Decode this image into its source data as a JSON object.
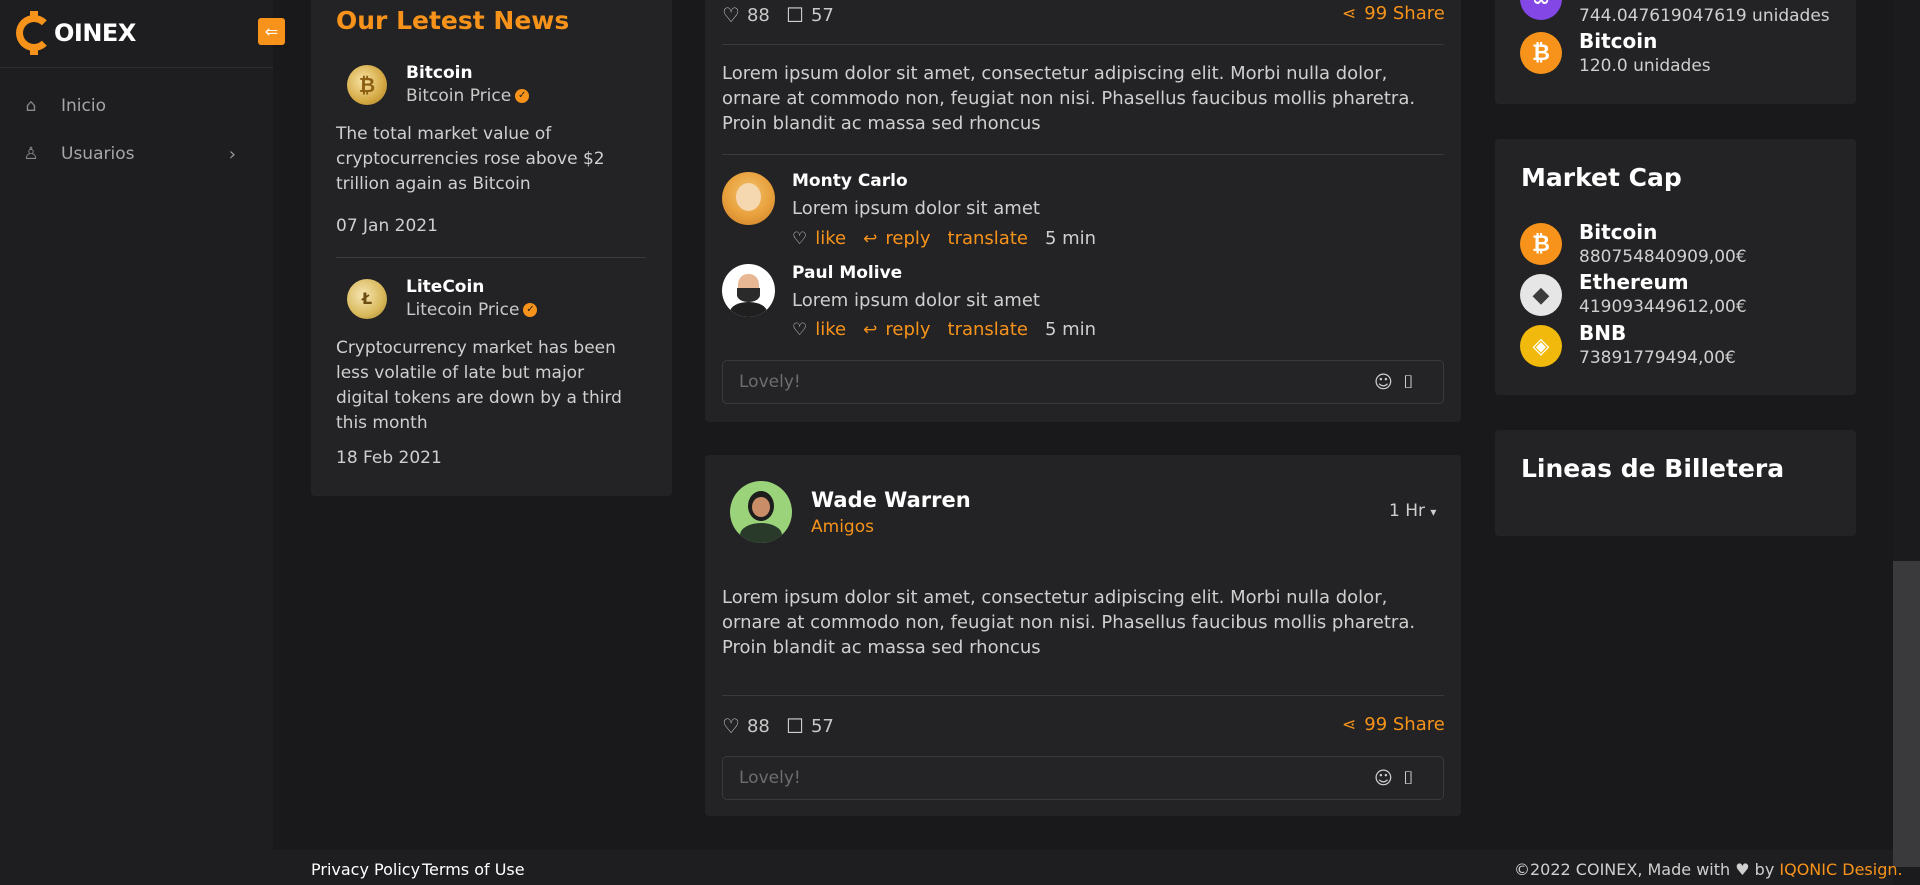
{
  "brand": {
    "name": "OINEX",
    "accent": "#f7931a",
    "collapse_icon": "arrow-left-icon"
  },
  "sidebar": {
    "items": [
      {
        "label": "Inicio",
        "icon": "home-icon"
      },
      {
        "label": "Usuarios",
        "icon": "user-icon",
        "chevron": "chevron-right-icon"
      }
    ]
  },
  "news": {
    "title": "Our Letest News",
    "items": [
      {
        "name": "Bitcoin",
        "sub": "Bitcoin Price",
        "body": "The total market value of cryptocurrencies rose above $2 trillion again as Bitcoin",
        "date": "07 Jan 2021"
      },
      {
        "name": "LiteCoin",
        "sub": "Litecoin Price",
        "body": "Cryptocurrency market has been less volatile of late but major digital tokens are down by a third this month",
        "date": "18 Feb 2021"
      }
    ]
  },
  "post1": {
    "likes": "88",
    "comments": "57",
    "share": "99 Share",
    "text": "Lorem ipsum dolor sit amet, consectetur adipiscing elit. Morbi nulla dolor, ornare at commodo non, feugiat non nisi. Phasellus faucibus mollis pharetra. Proin blandit ac massa sed rhoncus",
    "comments_list": [
      {
        "name": "Monty Carlo",
        "text": "Lorem ipsum dolor sit amet",
        "like": "like",
        "reply": "reply",
        "translate": "translate",
        "time": "5 min"
      },
      {
        "name": "Paul Molive",
        "text": "Lorem ipsum dolor sit amet",
        "like": "like",
        "reply": "reply",
        "translate": "translate",
        "time": "5 min"
      }
    ],
    "input_placeholder": "Lovely!"
  },
  "post2": {
    "author": "Wade Warren",
    "audience": "Amigos",
    "time": "1 Hr",
    "text": "Lorem ipsum dolor sit amet, consectetur adipiscing elit. Morbi nulla dolor, ornare at commodo non, feugiat non nisi. Phasellus faucibus mollis pharetra. Proin blandit ac massa sed rhoncus",
    "likes": "88",
    "comments": "57",
    "share": "99 Share",
    "input_placeholder": "Lovely!"
  },
  "wallet_top": {
    "items": [
      {
        "name": "",
        "value": "744.047619047619 unidades",
        "color": "#8247e5"
      },
      {
        "name": "Bitcoin",
        "value": "120.0 unidades",
        "color": "#f7931a"
      }
    ]
  },
  "market_cap": {
    "title": "Market Cap",
    "items": [
      {
        "name": "Bitcoin",
        "value": "880754840909,00€",
        "color": "#f7931a"
      },
      {
        "name": "Ethereum",
        "value": "419093449612,00€",
        "color": "#e6e6e6"
      },
      {
        "name": "BNB",
        "value": "73891779494,00€",
        "color": "#f0b90b"
      }
    ]
  },
  "wallet_lines": {
    "title": "Lineas de Billetera"
  },
  "footer": {
    "privacy": "Privacy Policy",
    "terms": "Terms of Use",
    "copyright": "©2022 COINEX, Made with",
    "by": "by",
    "designer": "IQONIC Design."
  }
}
